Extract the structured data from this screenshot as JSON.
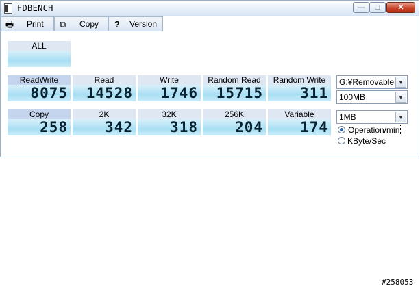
{
  "window": {
    "title": "FDBENCH",
    "caption_buttons": {
      "minimize": "—",
      "maximize": "□",
      "close": "✕"
    }
  },
  "toolbar": {
    "print_label": "Print",
    "copy_label": "Copy",
    "version_label": "Version",
    "icons": {
      "print": "printer-icon",
      "copy": "copy-icon",
      "version": "help-icon"
    }
  },
  "benchmarks": {
    "all": {
      "label": "ALL",
      "value": ""
    },
    "row1": [
      {
        "label": "ReadWrite",
        "value": "8075"
      },
      {
        "label": "Read",
        "value": "14528"
      },
      {
        "label": "Write",
        "value": "1746"
      },
      {
        "label": "Random Read",
        "value": "15715"
      },
      {
        "label": "Random Write",
        "value": "311"
      }
    ],
    "row2": [
      {
        "label": "Copy",
        "value": "258"
      },
      {
        "label": "2K",
        "value": "342"
      },
      {
        "label": "32K",
        "value": "318"
      },
      {
        "label": "256K",
        "value": "204"
      },
      {
        "label": "Variable",
        "value": "174"
      }
    ]
  },
  "settings": {
    "drive": "G:¥Removable",
    "size": "100MB",
    "block": "1MB",
    "units": [
      {
        "label": "Operation/min",
        "selected": true
      },
      {
        "label": "KByte/Sec",
        "selected": false
      }
    ]
  },
  "watermark": "#258053",
  "colors": {
    "display_bg": "#bde6f6",
    "label_bg": "#dfe7f3",
    "selected_label_bg": "#c6d5ee"
  }
}
